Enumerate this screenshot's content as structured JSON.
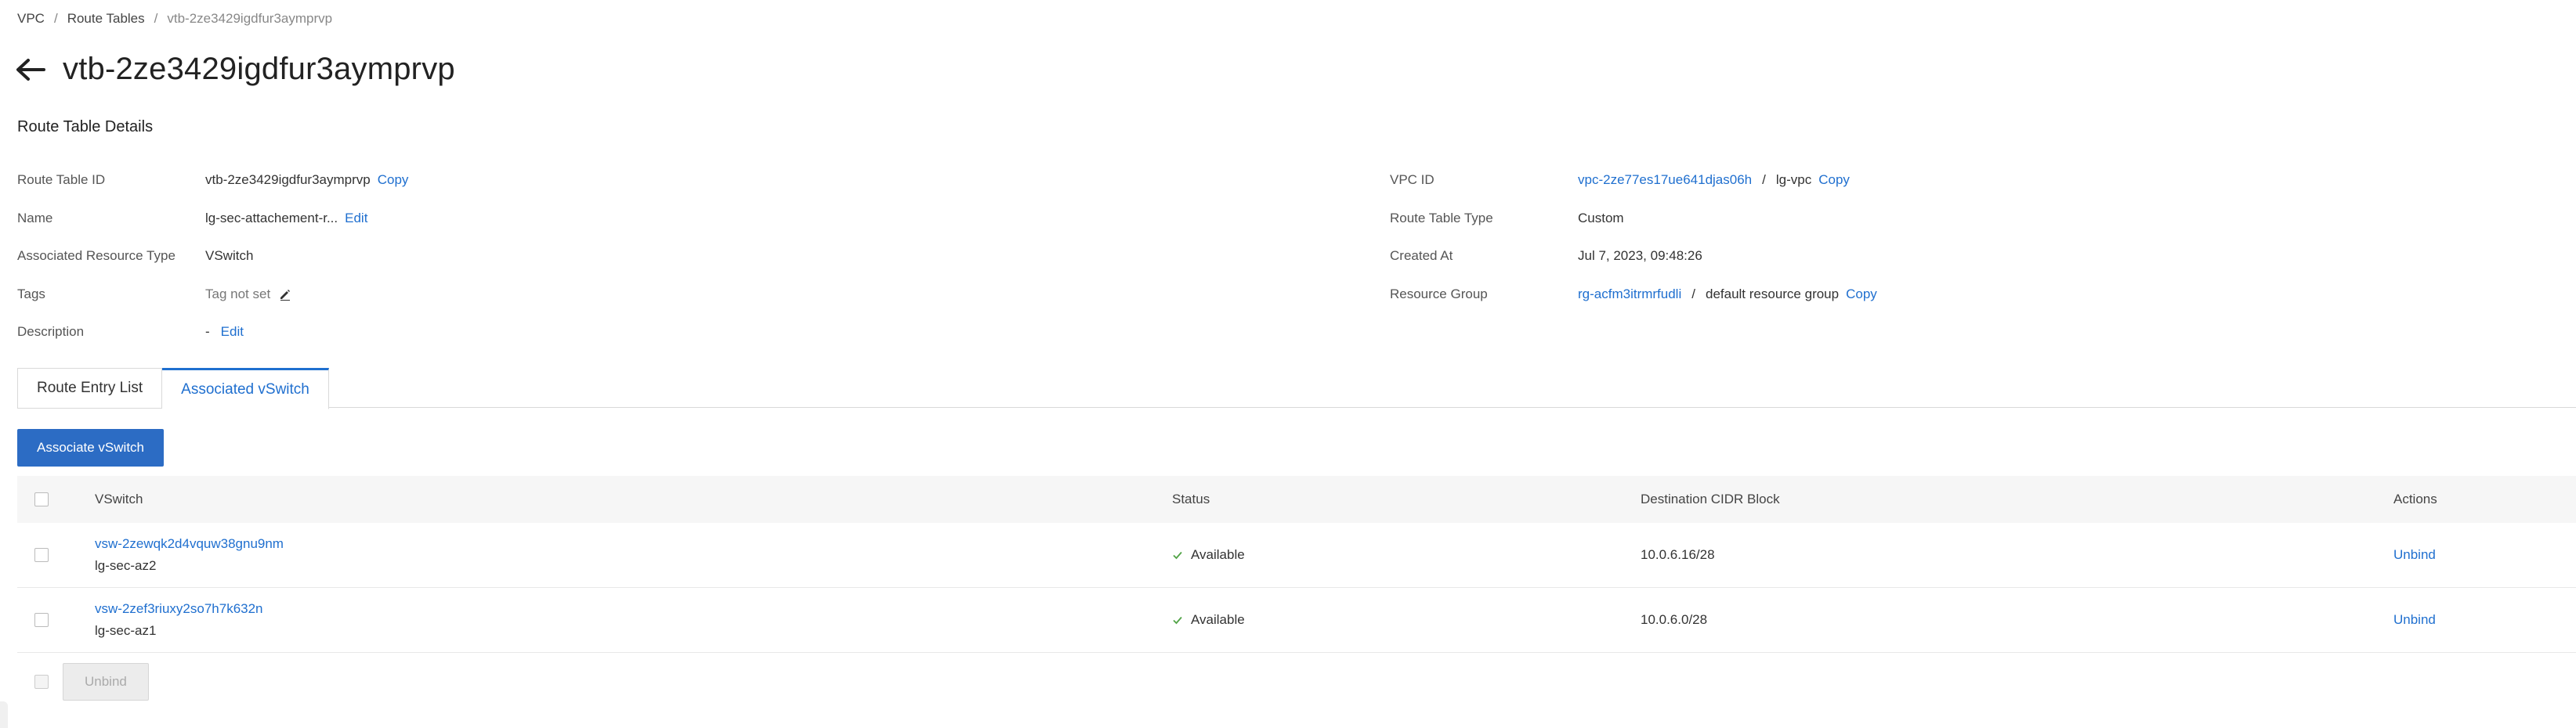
{
  "breadcrumb": {
    "items": [
      "VPC",
      "Route Tables",
      "vtb-2ze3429igdfur3aymprvp"
    ],
    "separator": "/"
  },
  "header": {
    "title": "vtb-2ze3429igdfur3aymprvp",
    "back_icon": "arrow-left-icon"
  },
  "details": {
    "section_title": "Route Table Details",
    "left": {
      "route_table_id": {
        "label": "Route Table ID",
        "value": "vtb-2ze3429igdfur3aymprvp",
        "action": "Copy"
      },
      "name": {
        "label": "Name",
        "value": "lg-sec-attachement-r...",
        "action": "Edit"
      },
      "resource_type": {
        "label": "Associated Resource Type",
        "value": "VSwitch"
      },
      "tags": {
        "label": "Tags",
        "value": "Tag not set",
        "icon": "pencil-icon"
      },
      "description": {
        "label": "Description",
        "value": "-",
        "action": "Edit"
      }
    },
    "right": {
      "vpc_id": {
        "label": "VPC ID",
        "link": "vpc-2ze77es17ue641djas06h",
        "separator": "/",
        "name": "lg-vpc",
        "action": "Copy"
      },
      "route_table_type": {
        "label": "Route Table Type",
        "value": "Custom"
      },
      "created_at": {
        "label": "Created At",
        "value": "Jul 7, 2023, 09:48:26"
      },
      "resource_group": {
        "label": "Resource Group",
        "link": "rg-acfm3itrmrfudli",
        "separator": "/",
        "name": "default resource group",
        "action": "Copy"
      }
    }
  },
  "tabs": [
    {
      "label": "Route Entry List",
      "active": false
    },
    {
      "label": "Associated vSwitch",
      "active": true
    }
  ],
  "toolbar": {
    "associate_label": "Associate vSwitch"
  },
  "table": {
    "columns": {
      "vswitch": "VSwitch",
      "status": "Status",
      "cidr": "Destination CIDR Block",
      "actions": "Actions"
    },
    "rows": [
      {
        "id": "vsw-2zewqk2d4vquw38gnu9nm",
        "name": "lg-sec-az2",
        "status": "Available",
        "cidr": "10.0.6.16/28",
        "action": "Unbind"
      },
      {
        "id": "vsw-2zef3riuxy2so7h7k632n",
        "name": "lg-sec-az1",
        "status": "Available",
        "cidr": "10.0.6.0/28",
        "action": "Unbind"
      }
    ]
  },
  "footer": {
    "unbind_label": "Unbind"
  },
  "colors": {
    "accent": "#1f6fcf",
    "primary_button": "#2c6cc4",
    "success": "#52a447"
  }
}
